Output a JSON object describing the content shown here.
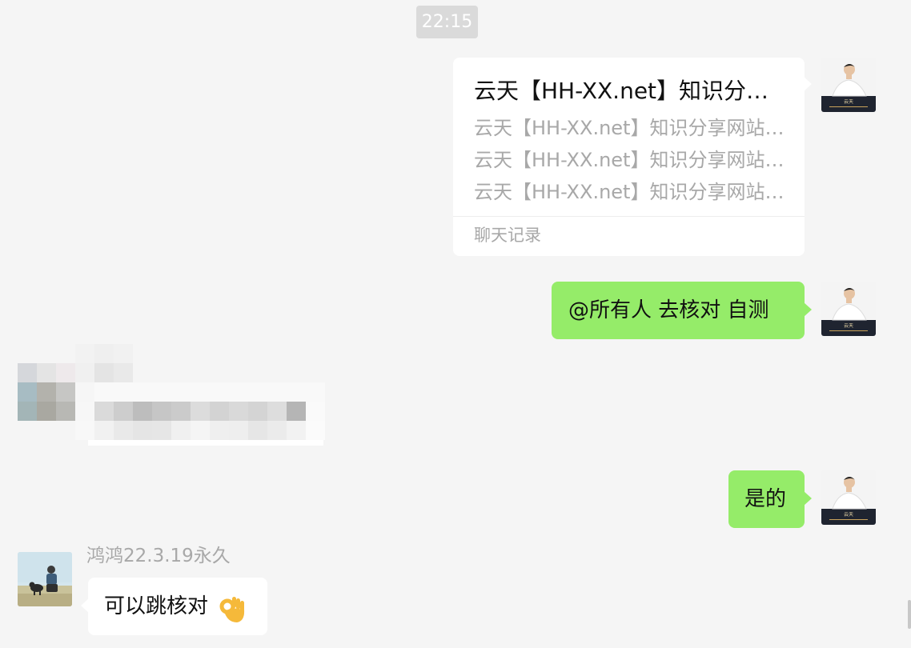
{
  "timestamp": "22:15",
  "merged_record": {
    "title": "云天【HH-XX.net】知识分享网站：专注分享优质资源",
    "lines": [
      "云天【HH-XX.net】知识分享网站：专注分享优质资源",
      "云天【HH-XX.net】知识分享网站：专注分享优质资源",
      "云天【HH-XX.net】知识分享网站：专注分享优质资源"
    ],
    "footer": "聊天记录"
  },
  "messages": {
    "mention": "@所有人 去核对  自测",
    "reply_yes": "是的",
    "received_text": "可以跳核对"
  },
  "received_sender": "鸿鸿22.3.19永久",
  "avatars": {
    "self": "self-avatar-man-white-shirt",
    "self_caption": "云天",
    "other": "other-avatar-person-with-dog"
  },
  "colors": {
    "background": "#f5f5f5",
    "sent_bubble": "#95ec69",
    "received_bubble": "#ffffff",
    "muted_text": "#a8a8a8"
  }
}
